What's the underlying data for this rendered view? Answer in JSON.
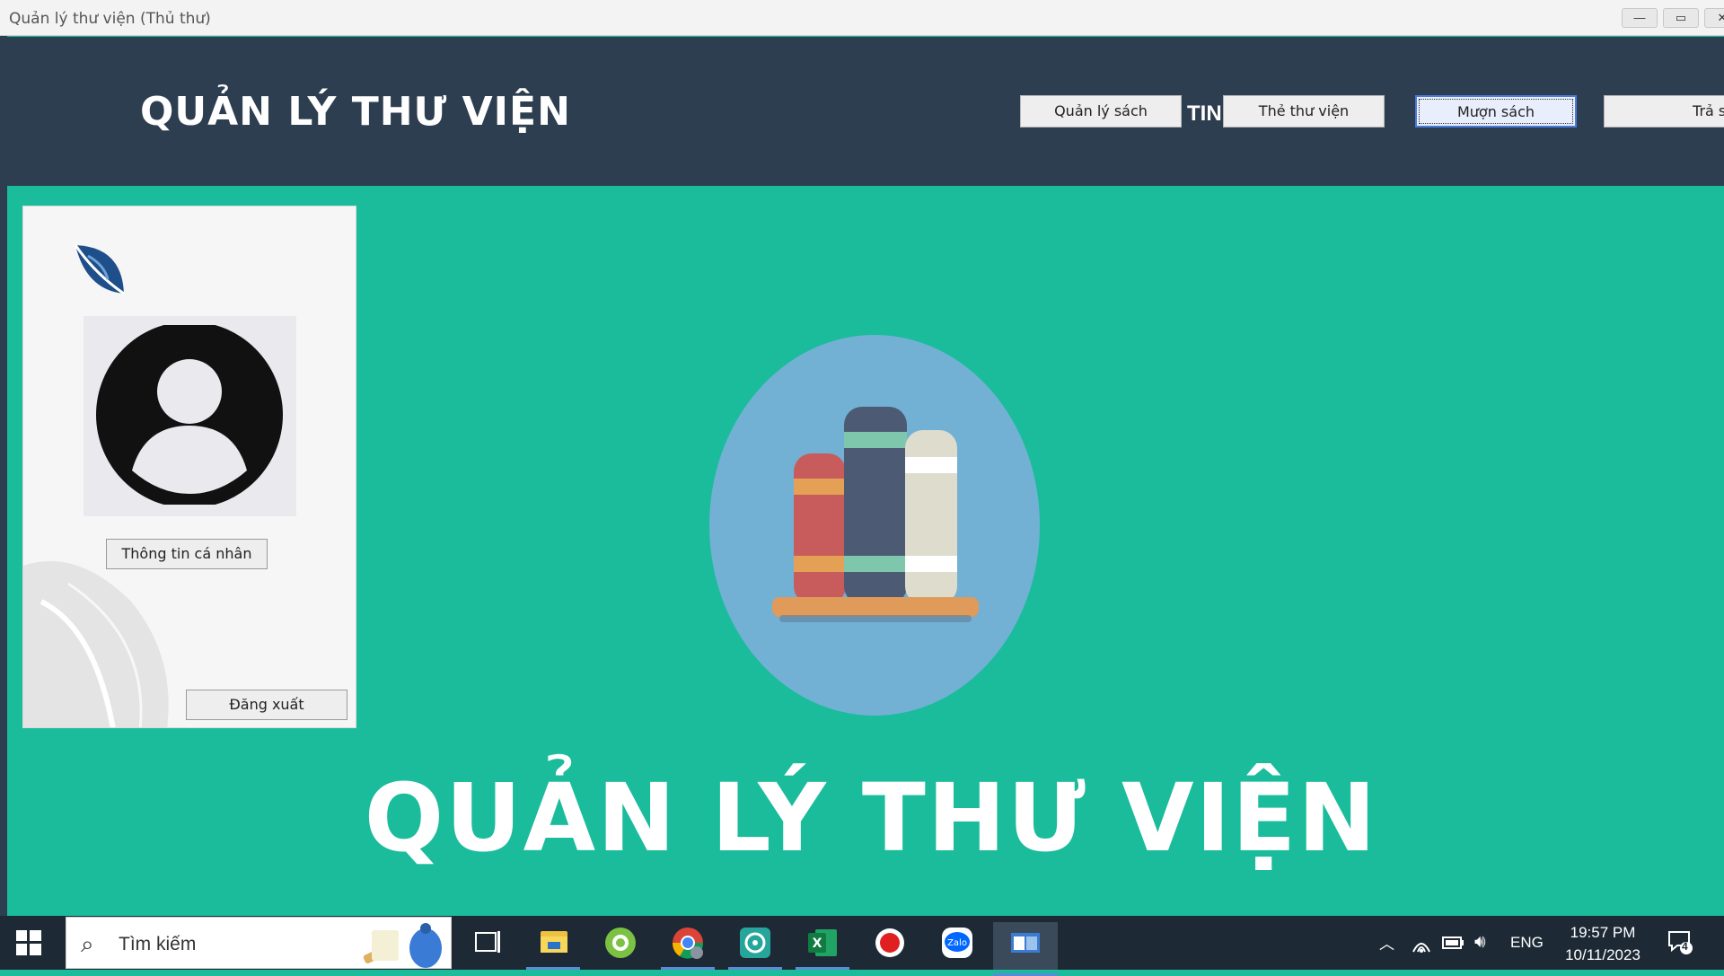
{
  "window": {
    "title": "Quản lý thư viện (Thủ thư)"
  },
  "header": {
    "app_title": "QUẢN LÝ THƯ VIỆN",
    "nav": [
      {
        "label": "Quản lý sách"
      },
      {
        "label": "Thẻ thư viện"
      },
      {
        "label": "Mượn sách"
      },
      {
        "label": "Trả sách"
      }
    ],
    "partial_label": "TIN"
  },
  "profile": {
    "info_button": "Thông tin cá nhân",
    "logout_button": "Đăng xuất"
  },
  "hero": {
    "text": "QUẢN LÝ THƯ VIỆN"
  },
  "taskbar": {
    "search_placeholder": "Tìm kiếm",
    "language": "ENG",
    "time": "19:57 PM",
    "date": "10/11/2023",
    "notification_count": "4"
  },
  "colors": {
    "header_bg": "#2d3e50",
    "main_bg": "#1abc9c",
    "taskbar_bg": "#1d2a36",
    "hero_circle": "#72b1d4"
  }
}
